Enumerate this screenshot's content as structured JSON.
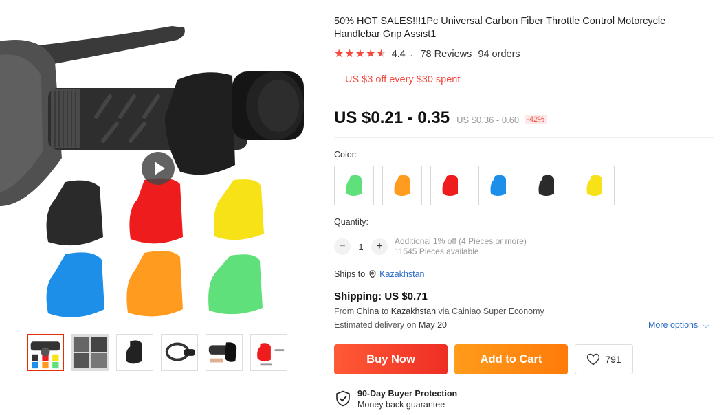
{
  "product": {
    "title": "50% HOT SALES!!!1Pc Universal Carbon Fiber Throttle Control Motorcycle Handlebar Grip Assist1",
    "rating": "4.4",
    "reviews": "78 Reviews",
    "orders": "94 orders",
    "coupon": "US $3 off every $30 spent",
    "price": "US $0.21 - 0.35",
    "old_price": "US $0.36 - 0.60",
    "discount": "-42%"
  },
  "variants": {
    "color_label": "Color:",
    "colors": [
      {
        "name": "green",
        "hex": "#5fe07a"
      },
      {
        "name": "orange",
        "hex": "#ff9b1e"
      },
      {
        "name": "red",
        "hex": "#ee1c1c"
      },
      {
        "name": "blue",
        "hex": "#1d8fe8"
      },
      {
        "name": "black",
        "hex": "#2b2b2b"
      },
      {
        "name": "yellow",
        "hex": "#f6e216"
      }
    ]
  },
  "quantity": {
    "label": "Quantity:",
    "value": "1",
    "note_line1": "Additional 1% off (4 Pieces or more)",
    "note_line2": "11545 Pieces available"
  },
  "shipping": {
    "ships_to_label": "Ships to",
    "country": "Kazakhstan",
    "cost": "Shipping: US $0.71",
    "from_prefix": "From",
    "from_origin": "China",
    "from_to": "to",
    "from_dest": "Kazakhstan",
    "from_suffix": "via Cainiao Super Economy",
    "est_prefix": "Estimated delivery on",
    "est_date": "May 20",
    "more_options": "More options"
  },
  "actions": {
    "buy_now": "Buy Now",
    "add_to_cart": "Add to Cart",
    "wishlist_count": "791"
  },
  "protection": {
    "title": "90-Day Buyer Protection",
    "subtitle": "Money back guarantee"
  },
  "colors": {
    "accent_red": "#f5473c",
    "link_blue": "#2a6ac9",
    "buy_gradient": "#ee2e24",
    "cart_gradient": "#ff7a0a"
  }
}
